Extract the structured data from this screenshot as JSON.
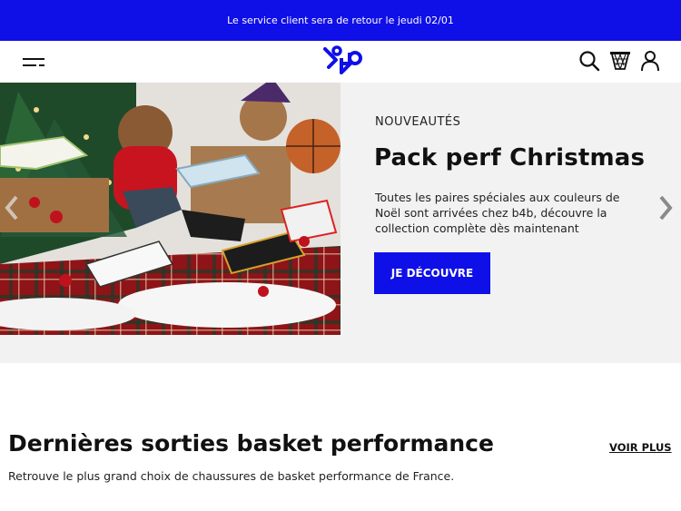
{
  "banner": {
    "text": "Le service client sera de retour le jeudi 02/01"
  },
  "header": {
    "menu_icon": "menu-icon",
    "logo_icon": "b4b-logo",
    "icons": [
      "search-icon",
      "basket-hoop-icon",
      "user-icon"
    ]
  },
  "hero": {
    "eyebrow": "NOUVEAUTÉS",
    "title": "Pack perf Christmas",
    "description": "Toutes les paires spéciales aux couleurs de Noël sont arrivées chez b4b, découvre la collection complète dès maintenant",
    "cta_label": "JE DÉCOUVRE",
    "prev_icon": "chevron-left-icon",
    "next_icon": "chevron-right-icon"
  },
  "section": {
    "title": "Dernières sorties basket performance",
    "link_label": "VOIR PLUS",
    "subtitle": "Retrouve le plus grand choix de chaussures de basket performance de France."
  },
  "colors": {
    "brand_blue": "#0f0fe8",
    "hero_bg": "#f3f2f2"
  }
}
